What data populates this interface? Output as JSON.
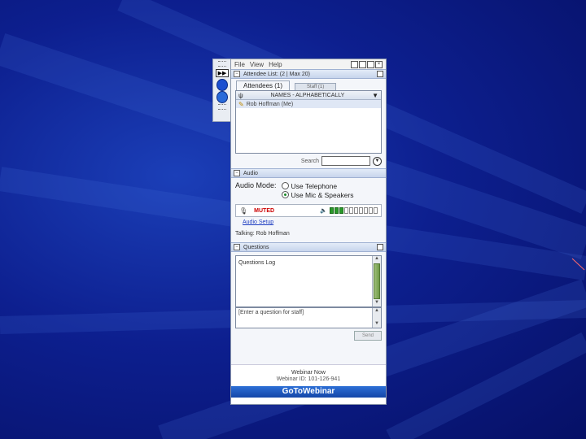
{
  "menu": {
    "file": "File",
    "view": "View",
    "help": "Help"
  },
  "attendee_section": {
    "title": "Attendee List: (2 | Max 20)",
    "tab_attendees": "Attendees (1)",
    "tab_staff": "Staff (1)",
    "sort_label": "NAMES - ALPHABETICALLY",
    "attendees": [
      {
        "name": "Rob Hoffman (Me)"
      }
    ],
    "search_label": "Search"
  },
  "audio_section": {
    "title": "Audio",
    "mode_label": "Audio Mode:",
    "option_telephone": "Use Telephone",
    "option_mic": "Use Mic & Speakers",
    "selected": "Use Mic & Speakers",
    "mic_status": "MUTED",
    "speaker_level": 0.3,
    "setup_link": "Audio Setup",
    "talking": "Talking: Rob Hoffman"
  },
  "questions_section": {
    "title": "Questions",
    "log_label": "Questions Log",
    "input_placeholder": "[Enter a question for staff]",
    "send_label": "Send"
  },
  "footer": {
    "title": "Webinar Now",
    "webinar_id": "Webinar ID: 101-126-941",
    "logo": "GoToWebinar"
  },
  "colors": {
    "background": "#0d1f8f",
    "accent": "#1446a8",
    "muted": "#cc0000",
    "meter": "#2a9a2a"
  }
}
